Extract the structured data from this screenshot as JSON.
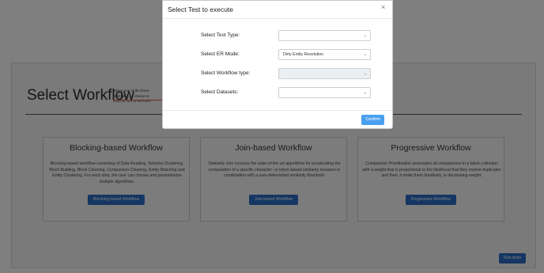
{
  "page": {
    "title": "Select Workflow",
    "help_text": "Select one of the three workflows or choose to execute one of the tests",
    "run_tests_label": "Run tests"
  },
  "cards": [
    {
      "title": "Blocking-based Workflow",
      "description": "Blocking-based workflow consisting of Data Reading, Schema Clustering, Block Building, Block Cleaning, Comparison Cleaning, Entity Matching and Entity Clustering. For each step, the user can choose and parameterize multiple algorithms.",
      "button": "Blocking-based Workflow"
    },
    {
      "title": "Join-based Workflow",
      "description": "Similarity Join conveys the state-of-the-art algorithms for accelerating the computation of a specific character- or token-based similarity measure in combination with a user-determined similarity threshold.",
      "button": "Join-based Workflow"
    },
    {
      "title": "Progressive Workflow",
      "description": "Comparison Prioritization associates all comparisons in a block collection with a weight that is proportional to the likelihood that they involve duplicates and then, it emits them iteratively, in decreasing weight.",
      "button": "Progressive Workflow"
    }
  ],
  "modal": {
    "title": "Select Test to execute",
    "close": "×",
    "fields": [
      {
        "label": "Select Test Type:",
        "value": "",
        "disabled": false
      },
      {
        "label": "Select ER Mode:",
        "value": "Dirty Entity Resolution",
        "disabled": false
      },
      {
        "label": "Select Workflow type:",
        "value": "",
        "disabled": true
      },
      {
        "label": "Select Datasets:",
        "value": "",
        "disabled": false
      }
    ],
    "confirm_label": "Confirm"
  },
  "colors": {
    "primary_button": "#2b6cc4",
    "confirm_button": "#4aa0f0",
    "underline": "#d9534f"
  }
}
